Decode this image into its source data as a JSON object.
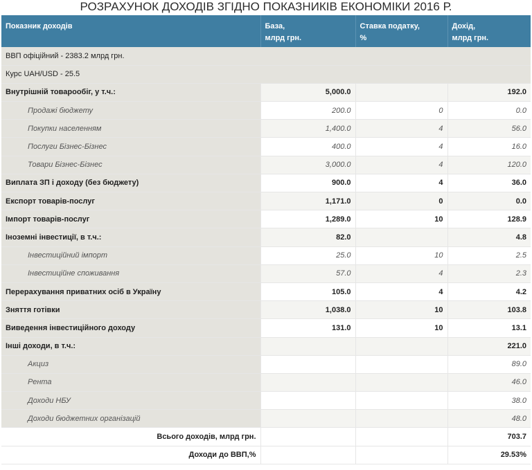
{
  "title": "РОЗРАХУНОК ДОХОДІВ ЗГІДНО ПОКАЗНИКІВ ЕКОНОМІКИ 2016 Р.",
  "header": {
    "col1": "Показник доходів",
    "col2_line1": "База,",
    "col2_line2": "млрд грн.",
    "col3_line1": "Ставка податку,",
    "col3_line2": "%",
    "col4_line1": "Дохід,",
    "col4_line2": "млрд грн."
  },
  "info": {
    "gdp": "ВВП офіційний - 2383.2 млрд грн.",
    "rate": "Курс UAH/USD - 25.5"
  },
  "rows": [
    {
      "name": "Внутрішній товарообіг, у т.ч.:",
      "base": "5,000.0",
      "tax": "",
      "income": "192.0"
    },
    {
      "name": "Продажі бюджету",
      "base": "200.0",
      "tax": "0",
      "income": "0.0"
    },
    {
      "name": "Покупки населенням",
      "base": "1,400.0",
      "tax": "4",
      "income": "56.0"
    },
    {
      "name": "Послуги Бізнес-Бізнес",
      "base": "400.0",
      "tax": "4",
      "income": "16.0"
    },
    {
      "name": "Товари Бізнес-Бізнес",
      "base": "3,000.0",
      "tax": "4",
      "income": "120.0"
    },
    {
      "name": "Виплата ЗП і доходу (без бюджету)",
      "base": "900.0",
      "tax": "4",
      "income": "36.0"
    },
    {
      "name": "Експорт товарів-послуг",
      "base": "1,171.0",
      "tax": "0",
      "income": "0.0"
    },
    {
      "name": "Імпорт товарів-послуг",
      "base": "1,289.0",
      "tax": "10",
      "income": "128.9"
    },
    {
      "name": "Іноземні інвестиції, в т.ч.:",
      "base": "82.0",
      "tax": "",
      "income": "4.8"
    },
    {
      "name": "Інвестиційний імпорт",
      "base": "25.0",
      "tax": "10",
      "income": "2.5"
    },
    {
      "name": "Інвестиційне споживання",
      "base": "57.0",
      "tax": "4",
      "income": "2.3"
    },
    {
      "name": "Перерахування приватних осіб в Україну",
      "base": "105.0",
      "tax": "4",
      "income": "4.2"
    },
    {
      "name": "Зняття готівки",
      "base": "1,038.0",
      "tax": "10",
      "income": "103.8"
    },
    {
      "name": "Виведення інвестиційного доходу",
      "base": "131.0",
      "tax": "10",
      "income": "13.1"
    },
    {
      "name": "Інші доходи, в т.ч.:",
      "base": "",
      "tax": "",
      "income": "221.0"
    },
    {
      "name": "Акциз",
      "base": "",
      "tax": "",
      "income": "89.0"
    },
    {
      "name": "Рента",
      "base": "",
      "tax": "",
      "income": "46.0"
    },
    {
      "name": "Доходи НБУ",
      "base": "",
      "tax": "",
      "income": "38.0"
    },
    {
      "name": "Доходи бюджетних організацій",
      "base": "",
      "tax": "",
      "income": "48.0"
    }
  ],
  "totals": {
    "total_label": "Всього доходів, млрд грн.",
    "total_value": "703.7",
    "gdp_label": "Доходи до ВВП,%",
    "gdp_value": "29.53%"
  }
}
